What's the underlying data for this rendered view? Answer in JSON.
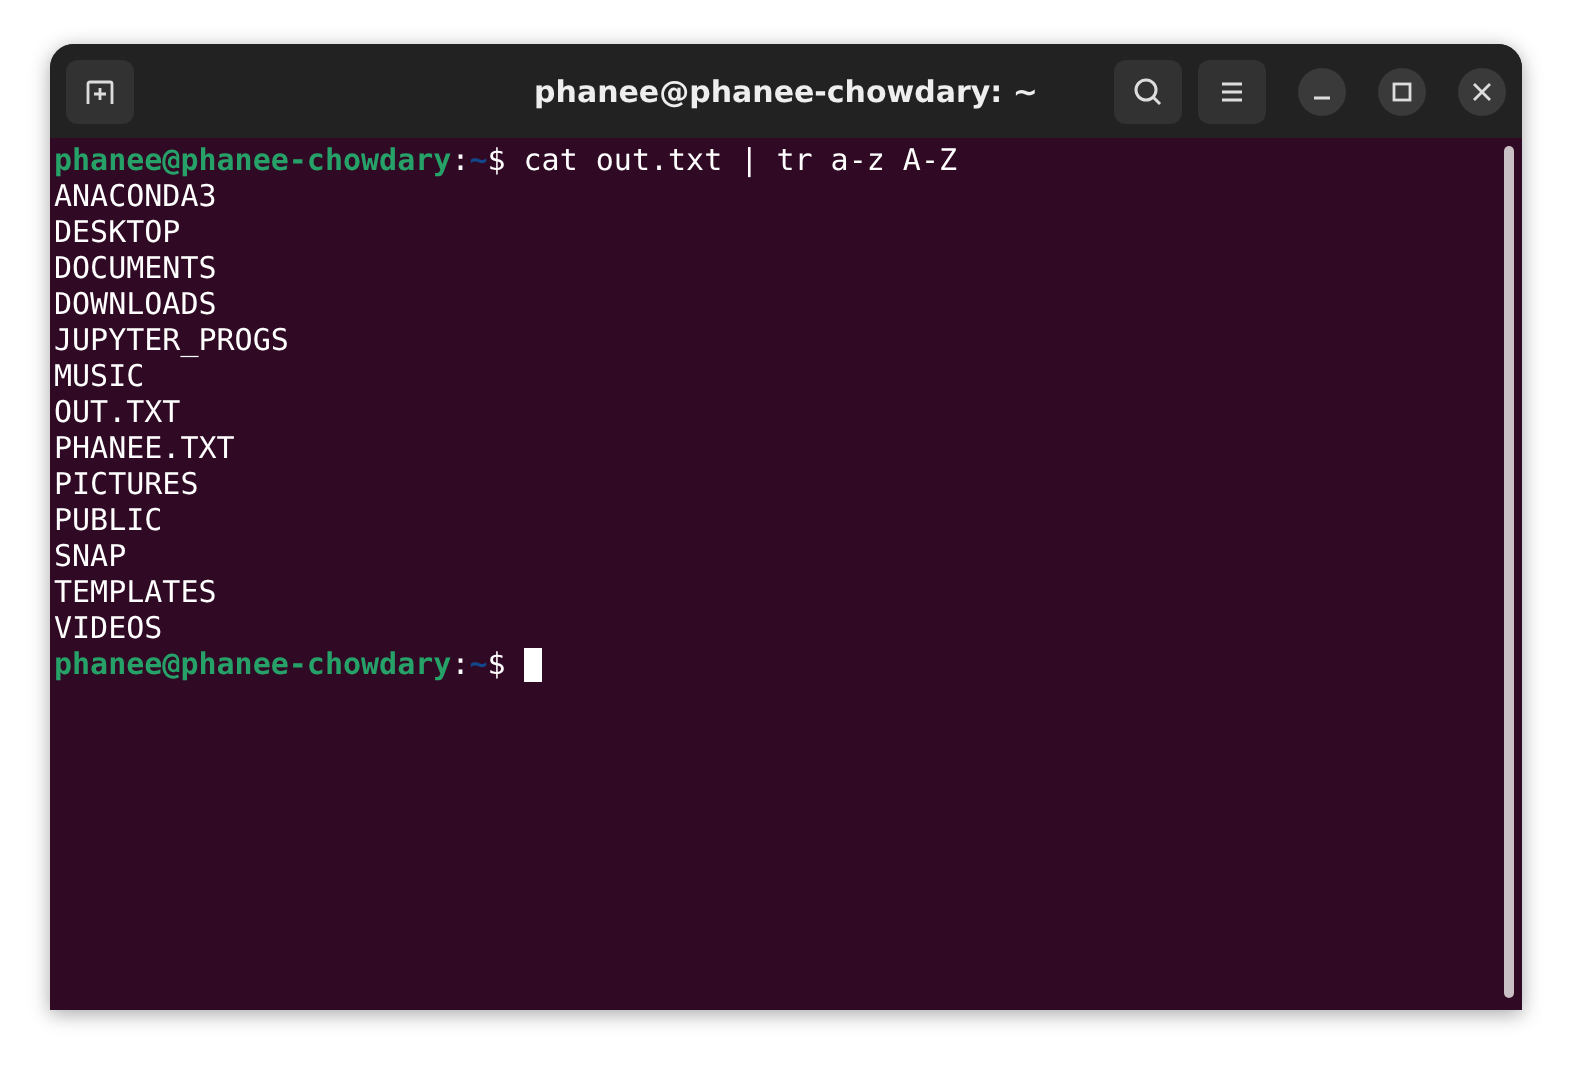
{
  "window": {
    "title": "phanee@phanee-chowdary: ~"
  },
  "terminal": {
    "lines": [
      {
        "kind": "prompt",
        "user_host": "phanee@phanee-chowdary",
        "separator": ":",
        "path": "~",
        "symbol": "$",
        "command": "cat out.txt | tr a-z A-Z",
        "cursor": false
      },
      {
        "kind": "output",
        "text": "ANACONDA3"
      },
      {
        "kind": "output",
        "text": "DESKTOP"
      },
      {
        "kind": "output",
        "text": "DOCUMENTS"
      },
      {
        "kind": "output",
        "text": "DOWNLOADS"
      },
      {
        "kind": "output",
        "text": "JUPYTER_PROGS"
      },
      {
        "kind": "output",
        "text": "MUSIC"
      },
      {
        "kind": "output",
        "text": "OUT.TXT"
      },
      {
        "kind": "output",
        "text": "PHANEE.TXT"
      },
      {
        "kind": "output",
        "text": "PICTURES"
      },
      {
        "kind": "output",
        "text": "PUBLIC"
      },
      {
        "kind": "output",
        "text": "SNAP"
      },
      {
        "kind": "output",
        "text": "TEMPLATES"
      },
      {
        "kind": "output",
        "text": "VIDEOS"
      },
      {
        "kind": "prompt",
        "user_host": "phanee@phanee-chowdary",
        "separator": ":",
        "path": "~",
        "symbol": "$",
        "cursor": true
      }
    ]
  }
}
